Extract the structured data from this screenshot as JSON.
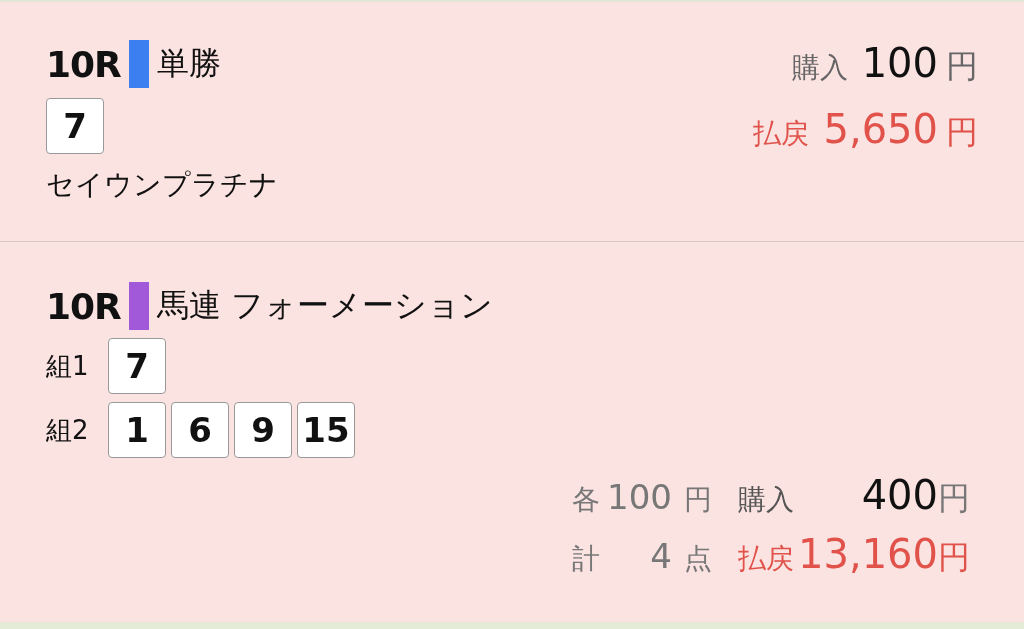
{
  "bets": [
    {
      "kind": "single",
      "race": "10R",
      "type": "単勝",
      "color": "#3b7ff0",
      "numbers": [
        "7"
      ],
      "horse": "セイウンプラチナ",
      "purchase_label": "購入",
      "purchase": "100",
      "purchase_yen": "円",
      "payout_label": "払戻",
      "payout": "5,650",
      "payout_yen": "円"
    },
    {
      "kind": "formation",
      "race": "10R",
      "type": "馬連 フォーメーション",
      "color": "#a259d9",
      "groups": [
        {
          "label": "組1",
          "numbers": [
            "7"
          ]
        },
        {
          "label": "組2",
          "numbers": [
            "1",
            "6",
            "9",
            "15"
          ]
        }
      ],
      "summary": {
        "each_label": "各",
        "each_amount": "100",
        "each_yen": "円",
        "purchase_label": "購入",
        "purchase": "400",
        "purchase_yen": "円",
        "count_label": "計",
        "count": "4",
        "count_unit": "点",
        "payout_label": "払戻",
        "payout": "13,160",
        "payout_yen": "円"
      }
    }
  ]
}
